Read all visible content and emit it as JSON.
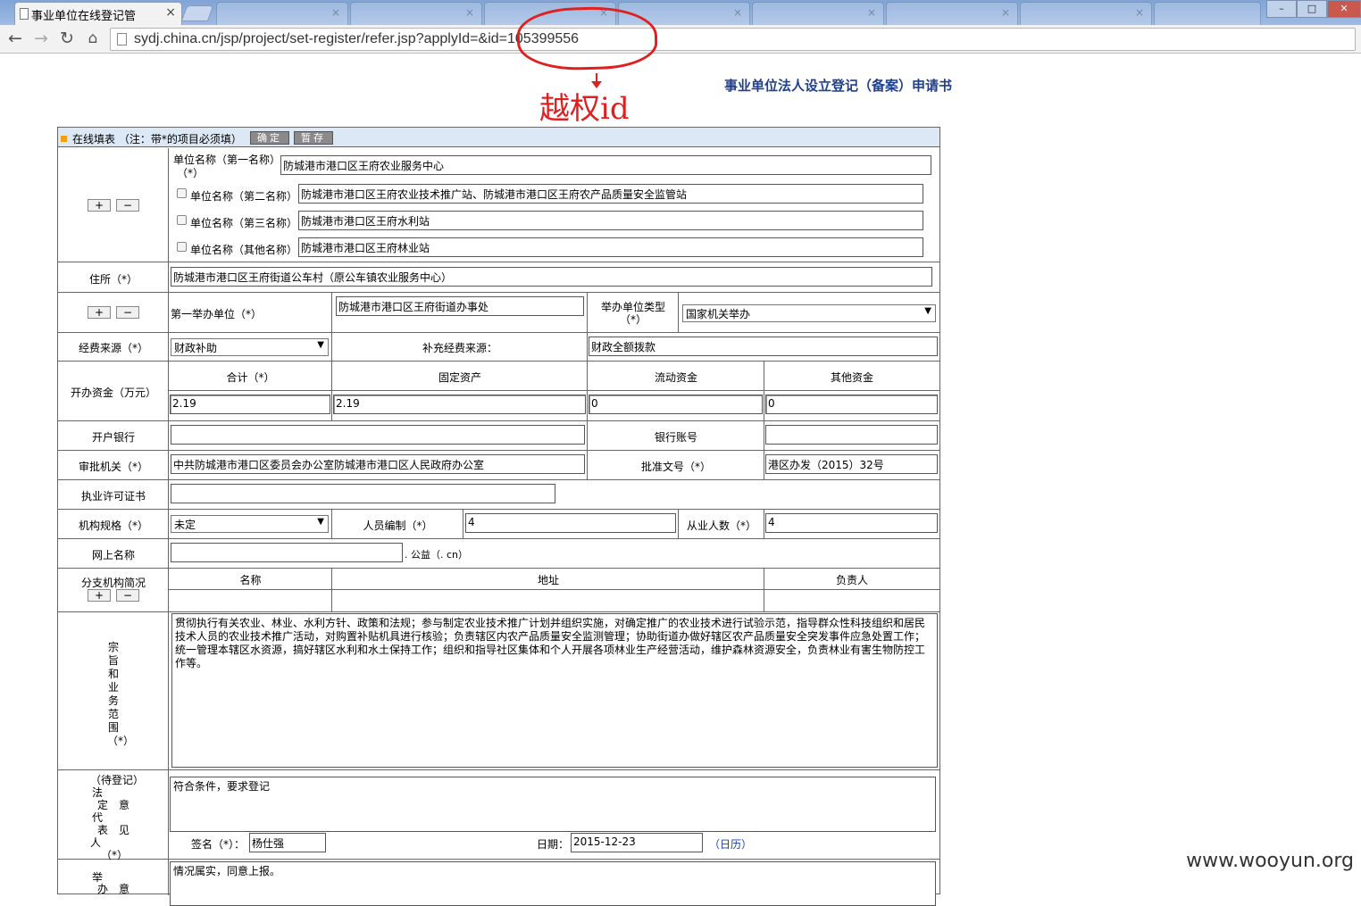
{
  "browser": {
    "active_tab_title": "事业单位在线登记管",
    "url": "sydj.china.cn/jsp/project/set-register/refer.jsp?applyId=&id=105399556",
    "close_glyph": "×"
  },
  "annotation": {
    "text": "越权id"
  },
  "page_title": "事业单位法人设立登记（备案）申请书",
  "form": {
    "header": {
      "text": "在线填表 （注：带*的项目必须填）",
      "confirm_btn": "确定",
      "save_btn": "暂存"
    },
    "names": {
      "first_label": "单位名称（第一名称）",
      "first_req": "（*）",
      "first_value": "防城港市港口区王府农业服务中心",
      "second_label": "单位名称（第二名称）",
      "second_value": "防城港市港口区王府农业技术推广站、防城港市港口区王府农产品质量安全监管站",
      "third_label": "单位名称（第三名称）",
      "third_value": "防城港市港口区王府水利站",
      "other_label": "单位名称（其他名称）",
      "other_value": "防城港市港口区王府林业站",
      "plus": "+",
      "minus": "−"
    },
    "address": {
      "label": "住所（*）",
      "value": "防城港市港口区王府街道公车村（原公车镇农业服务中心）"
    },
    "sponsor": {
      "label": "第一举办单位（*）",
      "value": "防城港市港口区王府街道办事处",
      "type_label": "举办单位类型",
      "type_req": "（*）",
      "type_value": "国家机关举办"
    },
    "funding": {
      "label": "经费来源（*）",
      "value": "财政补助",
      "extra_label": "补充经费来源：",
      "extra_value": "财政全额拨款"
    },
    "capital": {
      "label": "开办资金（万元）",
      "total_label": "合计（*）",
      "fixed_label": "固定资产",
      "liquid_label": "流动资金",
      "other_label": "其他资金",
      "total": "2.19",
      "fixed": "2.19",
      "liquid": "0",
      "other": "0"
    },
    "bank": {
      "label": "开户银行",
      "value": "",
      "account_label": "银行账号",
      "account_value": ""
    },
    "approval": {
      "label": "审批机关（*）",
      "value": "中共防城港市港口区委员会办公室防城港市港口区人民政府办公室",
      "doc_label": "批准文号（*）",
      "doc_value": "港区办发（2015）32号"
    },
    "license": {
      "label": "执业许可证书",
      "value": ""
    },
    "spec": {
      "label": "机构规格（*）",
      "value": "未定",
      "staff_label": "人员编制（*）",
      "staff_value": "4",
      "workers_label": "从业人数（*）",
      "workers_value": "4"
    },
    "web": {
      "label": "网上名称",
      "value": "",
      "suffix": ". 公益（. cn）"
    },
    "branches": {
      "label": "分支机构简况",
      "name_col": "名称",
      "addr_col": "地址",
      "head_col": "负责人"
    },
    "purpose": {
      "label": "宗旨和业务范围（*）",
      "text": "贯彻执行有关农业、林业、水利方针、政策和法规；参与制定农业技术推广计划并组织实施，对确定推广的农业技术进行试验示范，指导群众性科技组织和居民技术人员的农业技术推广活动，对购置补贴机具进行核验；负责辖区内农产品质量安全监测管理；协助街道办做好辖区农产品质量安全突发事件应急处置工作；统一管理本辖区水资源，搞好辖区水利和水土保持工作；组织和指导社区集体和个人开展各项林业生产经营活动，维护森林资源安全，负责林业有害生物防控工作等。"
    },
    "legal_rep": {
      "label_top": "（待登记）",
      "label_chars": [
        "法",
        "定",
        "意",
        "代",
        "表",
        "见",
        "人"
      ],
      "label_req": "（*）",
      "opinion": "符合条件，要求登记",
      "sign_label": "签名（*）：",
      "sign_value": "杨仕强",
      "date_label": "日期：",
      "date_value": "2015-12-23",
      "calendar_link": "（日历）"
    },
    "sponsor_opinion": {
      "label_chars": [
        "举",
        "办",
        "意"
      ],
      "text": "情况属实，同意上报。"
    }
  },
  "watermark": "www.wooyun.org"
}
